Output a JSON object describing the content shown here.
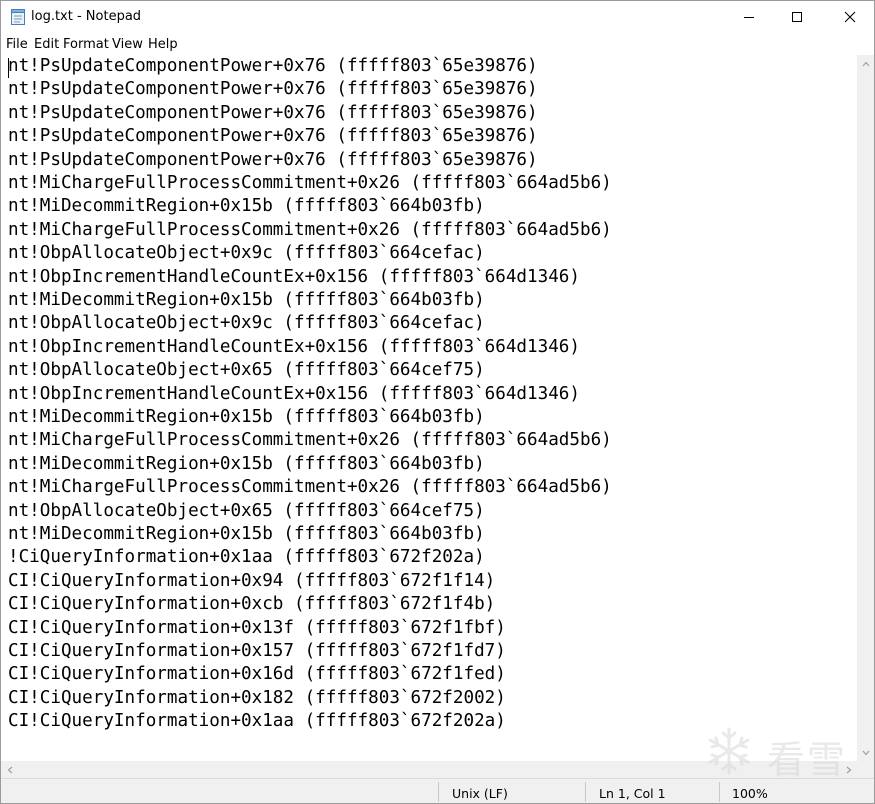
{
  "window": {
    "title": "log.txt - Notepad",
    "icon": "notepad-icon"
  },
  "controls": {
    "minimize": "minimize-icon",
    "maximize": "maximize-icon",
    "close": "close-icon"
  },
  "menu": [
    "File",
    "Edit",
    "Format",
    "View",
    "Help"
  ],
  "lines": [
    "nt!PsUpdateComponentPower+0x76 (fffff803`65e39876)",
    "nt!PsUpdateComponentPower+0x76 (fffff803`65e39876)",
    "nt!PsUpdateComponentPower+0x76 (fffff803`65e39876)",
    "nt!PsUpdateComponentPower+0x76 (fffff803`65e39876)",
    "nt!PsUpdateComponentPower+0x76 (fffff803`65e39876)",
    "nt!MiChargeFullProcessCommitment+0x26 (fffff803`664ad5b6)",
    "nt!MiDecommitRegion+0x15b (fffff803`664b03fb)",
    "nt!MiChargeFullProcessCommitment+0x26 (fffff803`664ad5b6)",
    "nt!ObpAllocateObject+0x9c (fffff803`664cefac)",
    "nt!ObpIncrementHandleCountEx+0x156 (fffff803`664d1346)",
    "nt!MiDecommitRegion+0x15b (fffff803`664b03fb)",
    "nt!ObpAllocateObject+0x9c (fffff803`664cefac)",
    "nt!ObpIncrementHandleCountEx+0x156 (fffff803`664d1346)",
    "nt!ObpAllocateObject+0x65 (fffff803`664cef75)",
    "nt!ObpIncrementHandleCountEx+0x156 (fffff803`664d1346)",
    "nt!MiDecommitRegion+0x15b (fffff803`664b03fb)",
    "nt!MiChargeFullProcessCommitment+0x26 (fffff803`664ad5b6)",
    "nt!MiDecommitRegion+0x15b (fffff803`664b03fb)",
    "nt!MiChargeFullProcessCommitment+0x26 (fffff803`664ad5b6)",
    "nt!ObpAllocateObject+0x65 (fffff803`664cef75)",
    "nt!MiDecommitRegion+0x15b (fffff803`664b03fb)",
    "!CiQueryInformation+0x1aa (fffff803`672f202a)",
    "CI!CiQueryInformation+0x94 (fffff803`672f1f14)",
    "CI!CiQueryInformation+0xcb (fffff803`672f1f4b)",
    "CI!CiQueryInformation+0x13f (fffff803`672f1fbf)",
    "CI!CiQueryInformation+0x157 (fffff803`672f1fd7)",
    "CI!CiQueryInformation+0x16d (fffff803`672f1fed)",
    "CI!CiQueryInformation+0x182 (fffff803`672f2002)",
    "CI!CiQueryInformation+0x1aa (fffff803`672f202a)"
  ],
  "status": {
    "line_ending": "Unix (LF)",
    "position": "Ln 1, Col 1",
    "zoom": "100%"
  },
  "watermark": {
    "icon": "snowflake-logo-icon",
    "text": "看雪"
  }
}
